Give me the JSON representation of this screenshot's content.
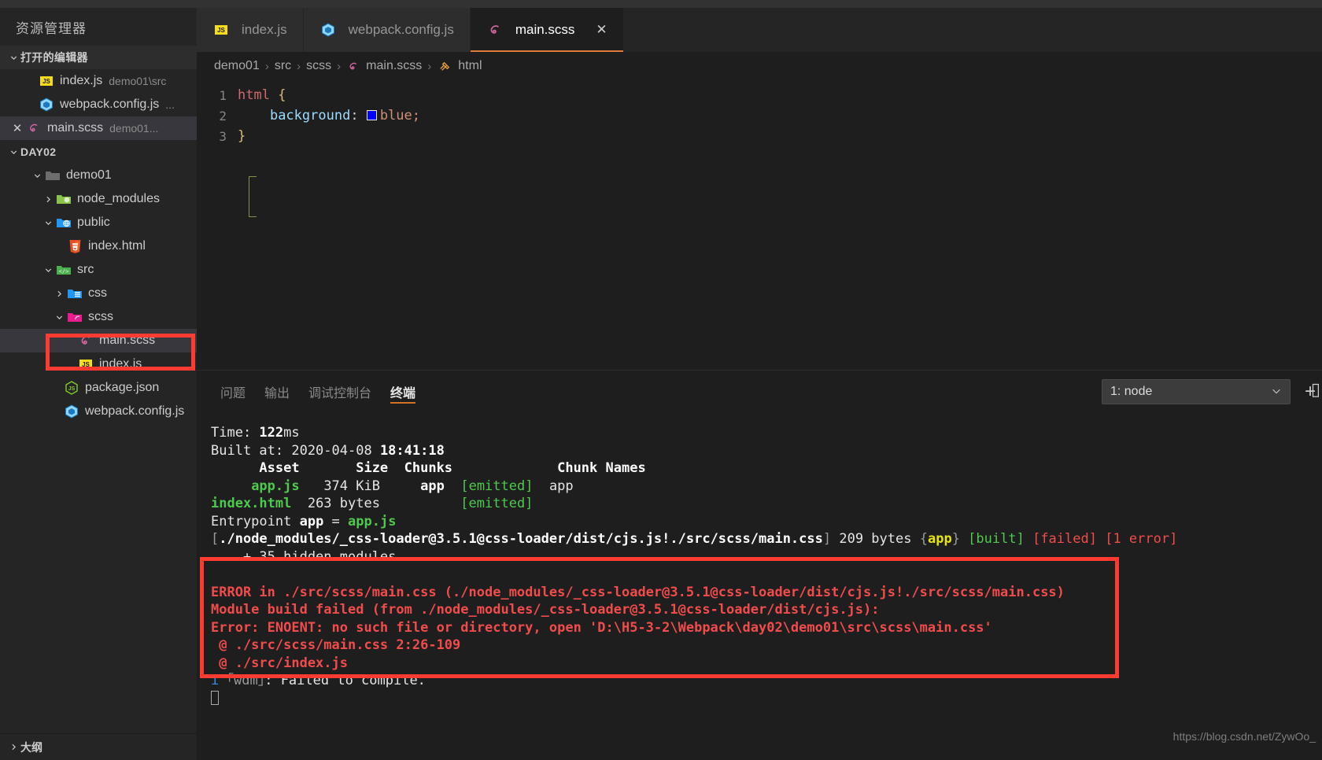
{
  "sidebar": {
    "title": "资源管理器",
    "open_editors_header": "打开的编辑器",
    "open_editors": [
      {
        "icon": "js-file-icon",
        "name": "index.js",
        "detail": "demo01\\src",
        "close": ""
      },
      {
        "icon": "webpack-file-icon",
        "name": "webpack.config.js",
        "detail": "...",
        "close": ""
      },
      {
        "icon": "scss-file-icon",
        "name": "main.scss",
        "detail": "demo01...",
        "close": "✕"
      }
    ],
    "workspace_header": "DAY02",
    "tree": [
      {
        "indent": 1,
        "arrow": "chevron-down",
        "icon": "folder-icon",
        "label": "demo01"
      },
      {
        "indent": 2,
        "arrow": "chevron-right",
        "icon": "node-modules-folder-icon",
        "label": "node_modules"
      },
      {
        "indent": 2,
        "arrow": "chevron-down",
        "icon": "public-folder-icon",
        "label": "public"
      },
      {
        "indent": 3,
        "arrow": "",
        "icon": "html-file-icon",
        "label": "index.html"
      },
      {
        "indent": 2,
        "arrow": "chevron-down",
        "icon": "src-folder-icon",
        "label": "src"
      },
      {
        "indent": 3,
        "arrow": "chevron-right",
        "icon": "css-folder-icon",
        "label": "css"
      },
      {
        "indent": 3,
        "arrow": "chevron-down",
        "icon": "scss-folder-icon",
        "label": "scss"
      },
      {
        "indent": 4,
        "arrow": "",
        "icon": "scss-file-icon",
        "label": "main.scss",
        "selected": true
      },
      {
        "indent": 4,
        "arrow": "",
        "icon": "js-file-icon",
        "label": "index.js"
      },
      {
        "indent": 3,
        "arrow": "",
        "icon": "json-file-icon",
        "label": "package.json"
      },
      {
        "indent": 3,
        "arrow": "",
        "icon": "webpack-file-icon",
        "label": "webpack.config.js"
      }
    ],
    "outline_label": "大纲"
  },
  "tabs": [
    {
      "icon": "js-file-icon",
      "label": "index.js",
      "active": false
    },
    {
      "icon": "webpack-file-icon",
      "label": "webpack.config.js",
      "active": false
    },
    {
      "icon": "scss-file-icon",
      "label": "main.scss",
      "active": true,
      "close": "✕"
    }
  ],
  "breadcrumb": {
    "items": [
      "demo01",
      "src",
      "scss",
      "main.scss",
      "html"
    ],
    "separator": "›",
    "file_icon": "scss-file-icon",
    "symbol_icon": "html-symbol-icon"
  },
  "editor": {
    "lines": [
      {
        "num": "1",
        "tag": "html",
        "space": " ",
        "brace": "{"
      },
      {
        "num": "2",
        "prop": "background",
        "colon": ":",
        "value": "blue;",
        "swatch_color": "#0000ff"
      },
      {
        "num": "3",
        "brace": "}"
      }
    ]
  },
  "panel": {
    "tabs": [
      {
        "label": "问题",
        "active": false
      },
      {
        "label": "输出",
        "active": false
      },
      {
        "label": "调试控制台",
        "active": false
      },
      {
        "label": "终端",
        "active": true
      }
    ],
    "terminal_selector": "1: node",
    "selector_arrow": "⌄",
    "add_icon": "+",
    "split_icon": "▯",
    "terminal_lines": [
      [
        {
          "t": "Time: ",
          "c": "c-white"
        },
        {
          "t": "122",
          "c": "c-bold"
        },
        {
          "t": "ms",
          "c": "c-white"
        }
      ],
      [
        {
          "t": "Built at: 2020-04-08 ",
          "c": "c-white"
        },
        {
          "t": "18:41:18",
          "c": "c-bold"
        }
      ],
      [
        {
          "t": "      Asset       Size  Chunks             ",
          "c": "c-bold"
        },
        {
          "t": "Chunk Names",
          "c": "c-bold"
        }
      ],
      [
        {
          "t": "     ",
          "c": "c-white"
        },
        {
          "t": "app.js",
          "c": "c-greenb"
        },
        {
          "t": "   374 KiB     ",
          "c": "c-white"
        },
        {
          "t": "app",
          "c": "c-bold"
        },
        {
          "t": "  ",
          "c": "c-white"
        },
        {
          "t": "[emitted]",
          "c": "c-green"
        },
        {
          "t": "  app",
          "c": "c-white"
        }
      ],
      [
        {
          "t": "index.html",
          "c": "c-greenb"
        },
        {
          "t": "  263 bytes          ",
          "c": "c-white"
        },
        {
          "t": "[emitted]",
          "c": "c-green"
        }
      ],
      [
        {
          "t": "Entrypoint ",
          "c": "c-white"
        },
        {
          "t": "app",
          "c": "c-bold"
        },
        {
          "t": " = ",
          "c": "c-white"
        },
        {
          "t": "app.js",
          "c": "c-greenb"
        }
      ],
      [
        {
          "t": "[",
          "c": "c-gray"
        },
        {
          "t": "./node_modules/_css-loader@3.5.1@css-loader/dist/cjs.js!./src/scss/main.css",
          "c": "c-bold"
        },
        {
          "t": "] ",
          "c": "c-gray"
        },
        {
          "t": "209 bytes ",
          "c": "c-white"
        },
        {
          "t": "{",
          "c": "c-gray"
        },
        {
          "t": "app",
          "c": "c-yellowb"
        },
        {
          "t": "} ",
          "c": "c-gray"
        },
        {
          "t": "[built]",
          "c": "c-green"
        },
        {
          "t": " ",
          "c": "c-white"
        },
        {
          "t": "[failed]",
          "c": "c-red"
        },
        {
          "t": " ",
          "c": "c-white"
        },
        {
          "t": "[1 error]",
          "c": "c-red"
        }
      ],
      [
        {
          "t": "    + 35 hidden modules",
          "c": "c-white"
        }
      ],
      [
        {
          "t": " ",
          "c": "c-white"
        }
      ],
      [
        {
          "t": "ERROR in ./src/scss/main.css (./node_modules/_css-loader@3.5.1@css-loader/dist/cjs.js!./src/scss/main.css)",
          "c": "c-redb"
        }
      ],
      [
        {
          "t": "Module build failed (from ./node_modules/_css-loader@3.5.1@css-loader/dist/cjs.js):",
          "c": "c-redb"
        }
      ],
      [
        {
          "t": "Error: ENOENT: no such file or directory, open 'D:\\H5-3-2\\Webpack\\day02\\demo01\\src\\scss\\main.css'",
          "c": "c-redb"
        }
      ],
      [
        {
          "t": " @ ./src/scss/main.css 2:26-109",
          "c": "c-redb"
        }
      ],
      [
        {
          "t": " @ ./src/index.js",
          "c": "c-redb"
        }
      ],
      [
        {
          "t": "i",
          "c": "c-blue"
        },
        {
          "t": " ",
          "c": "c-white"
        },
        {
          "t": "｢wdm｣",
          "c": "c-gray"
        },
        {
          "t": ": Failed to compile.",
          "c": "c-white"
        }
      ]
    ]
  },
  "annotations": {
    "file_highlight": "main-scss-tree-item-highlight",
    "terminal_highlight": "error-block-highlight",
    "color": "#fd3b30"
  },
  "watermark": "https://blog.csdn.net/ZywOo_"
}
